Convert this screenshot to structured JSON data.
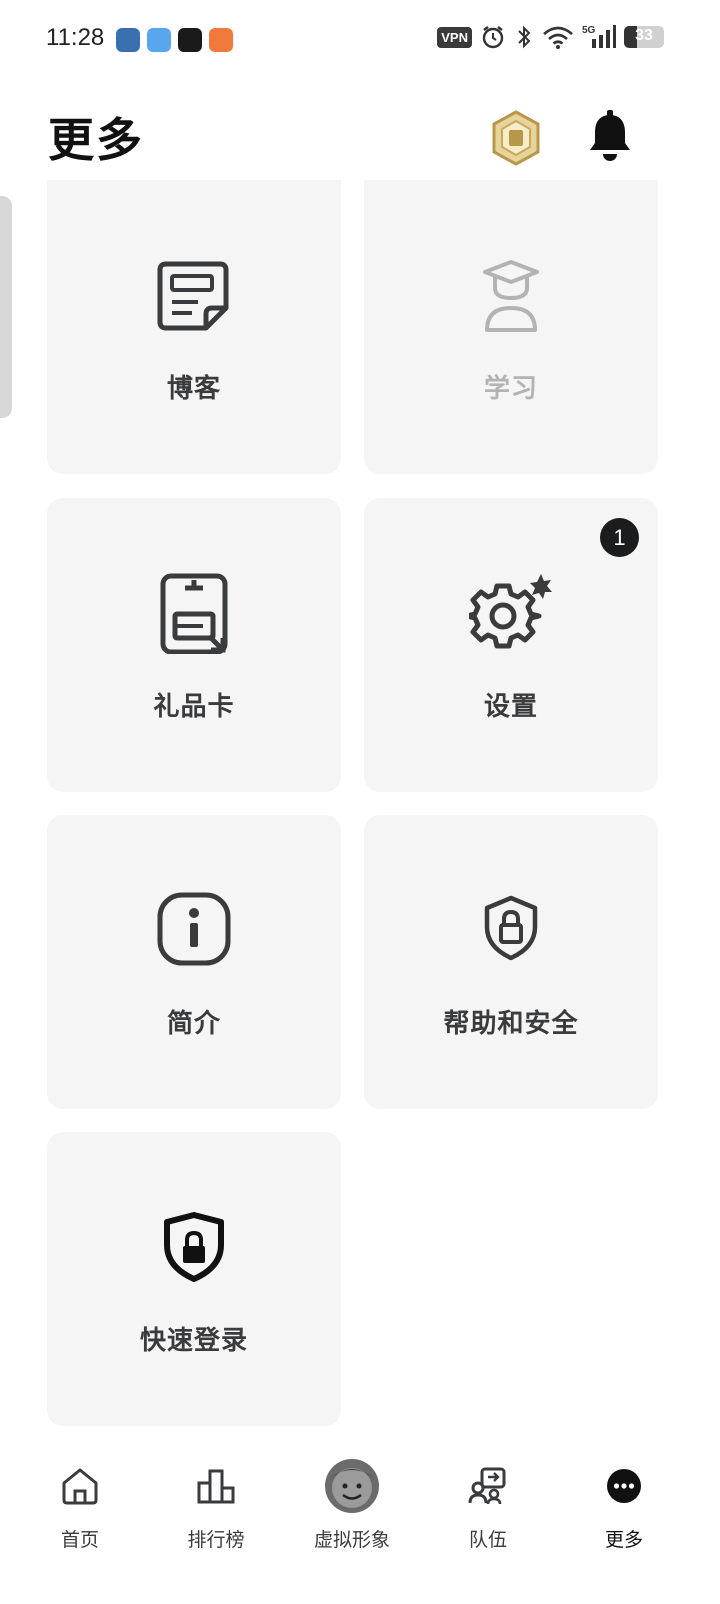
{
  "status_bar": {
    "time": "11:28",
    "apps": [
      {
        "name": "bilibili-app-icon",
        "color": "#3a6fb0"
      },
      {
        "name": "weather-app-icon",
        "color": "#5aa6ee"
      },
      {
        "name": "tiktok-app-icon",
        "color": "#1a1a1a"
      },
      {
        "name": "orange-app-icon",
        "color": "#f07a3c"
      }
    ],
    "vpn": "VPN",
    "network": "5G",
    "battery_level": "33",
    "battery_fraction": 0.33
  },
  "header": {
    "title": "更多",
    "coin_color": "#c9a85b",
    "accent_color": "#1b1c1e"
  },
  "grid": {
    "tiles": [
      {
        "label": "博客",
        "icon": "blog-icon"
      },
      {
        "label": "学习",
        "icon": "learn-icon",
        "faded": true
      },
      {
        "label": "礼品卡",
        "icon": "gift-card-icon"
      },
      {
        "label": "设置",
        "icon": "settings-icon",
        "badge": "1"
      },
      {
        "label": "简介",
        "icon": "info-icon"
      },
      {
        "label": "帮助和安全",
        "icon": "shield-lock-icon"
      },
      {
        "label": "快速登录",
        "icon": "quick-login-icon"
      }
    ]
  },
  "bottom_nav": {
    "items": [
      {
        "label": "首页",
        "icon": "home-icon"
      },
      {
        "label": "排行榜",
        "icon": "leaderboard-icon"
      },
      {
        "label": "虚拟形象",
        "icon": "avatar-icon"
      },
      {
        "label": "队伍",
        "icon": "team-icon"
      },
      {
        "label": "更多",
        "icon": "more-icon",
        "active": true
      }
    ]
  }
}
